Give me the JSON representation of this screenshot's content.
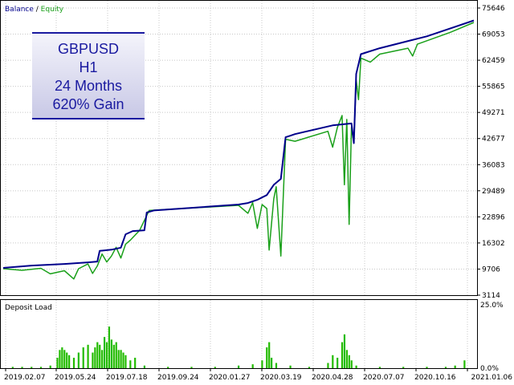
{
  "chart_data": [
    {
      "type": "line",
      "title_parts": [
        "Balance",
        " / ",
        "Equity"
      ],
      "colors": {
        "balance": "#00008b",
        "equity": "#1aa01a",
        "grid": "#c8c8c8",
        "text": "#000000"
      },
      "ylim": [
        3114,
        75646
      ],
      "yticks": [
        3114,
        9706,
        16302,
        22896,
        29489,
        36083,
        42677,
        49271,
        55865,
        62459,
        69053,
        75646
      ],
      "xticks": [
        "2019.02.07",
        "2019.05.24",
        "2019.07.18",
        "2019.09.24",
        "2020.01.27",
        "2020.03.19",
        "2020.04.28",
        "2020.07.07",
        "2020.10.16",
        "2021.01.06"
      ],
      "series": [
        {
          "name": "Balance",
          "x": [
            0,
            0.06,
            0.13,
            0.18,
            0.2,
            0.205,
            0.23,
            0.25,
            0.26,
            0.275,
            0.3,
            0.305,
            0.32,
            0.5,
            0.52,
            0.54,
            0.56,
            0.575,
            0.59,
            0.6,
            0.61,
            0.62,
            0.7,
            0.74,
            0.745,
            0.75,
            0.76,
            0.8,
            0.9,
            0.95,
            1.0
          ],
          "values": [
            10000,
            10600,
            11000,
            11400,
            11600,
            14300,
            14600,
            15100,
            18500,
            19300,
            19500,
            24000,
            24500,
            26000,
            26400,
            27200,
            28400,
            31000,
            32500,
            43000,
            43400,
            43800,
            46000,
            46500,
            41500,
            59000,
            64000,
            65500,
            68500,
            70500,
            72500
          ]
        },
        {
          "name": "Equity",
          "x": [
            0,
            0.04,
            0.08,
            0.1,
            0.13,
            0.15,
            0.16,
            0.18,
            0.19,
            0.2,
            0.21,
            0.22,
            0.23,
            0.24,
            0.25,
            0.26,
            0.27,
            0.29,
            0.31,
            0.5,
            0.52,
            0.53,
            0.54,
            0.55,
            0.56,
            0.565,
            0.575,
            0.58,
            0.59,
            0.6,
            0.62,
            0.69,
            0.7,
            0.71,
            0.72,
            0.725,
            0.73,
            0.735,
            0.74,
            0.745,
            0.75,
            0.755,
            0.76,
            0.78,
            0.8,
            0.86,
            0.87,
            0.88,
            0.95,
            1.0
          ],
          "values": [
            9800,
            9400,
            9900,
            8500,
            9300,
            7200,
            9800,
            11000,
            8600,
            10500,
            13500,
            11500,
            13000,
            15200,
            12500,
            16000,
            17000,
            19500,
            24500,
            25800,
            23800,
            26500,
            20000,
            26000,
            25000,
            14500,
            27500,
            30500,
            13000,
            42500,
            42000,
            44500,
            40500,
            45500,
            48500,
            31000,
            47500,
            21000,
            45500,
            41500,
            57500,
            52500,
            63000,
            62000,
            64000,
            65500,
            63500,
            66500,
            69500,
            72000
          ]
        }
      ]
    },
    {
      "type": "bar",
      "title": "Deposit Load",
      "ylim": [
        0,
        25
      ],
      "yticks": [
        "25.0%",
        "0.0%"
      ],
      "colors": {
        "bar": "#22bb00"
      },
      "x": [
        0.02,
        0.04,
        0.06,
        0.08,
        0.1,
        0.115,
        0.12,
        0.125,
        0.13,
        0.135,
        0.14,
        0.15,
        0.16,
        0.17,
        0.18,
        0.19,
        0.195,
        0.2,
        0.205,
        0.21,
        0.215,
        0.22,
        0.225,
        0.23,
        0.235,
        0.24,
        0.245,
        0.25,
        0.255,
        0.26,
        0.27,
        0.28,
        0.3,
        0.35,
        0.4,
        0.45,
        0.5,
        0.53,
        0.55,
        0.56,
        0.565,
        0.57,
        0.58,
        0.61,
        0.65,
        0.69,
        0.7,
        0.71,
        0.72,
        0.725,
        0.73,
        0.735,
        0.74,
        0.75,
        0.8,
        0.85,
        0.9,
        0.94,
        0.96,
        0.98
      ],
      "values": [
        0.5,
        0.5,
        0.5,
        0.5,
        1,
        4,
        7,
        8,
        7,
        6,
        5,
        4,
        6,
        8,
        9,
        6,
        8,
        10,
        9,
        7,
        12,
        10,
        16,
        11,
        9,
        10,
        7,
        7,
        6,
        5,
        3,
        4,
        1,
        0.5,
        0.5,
        0.5,
        1,
        1.5,
        3,
        8,
        10,
        4,
        2,
        1,
        0.5,
        2,
        5,
        4,
        10,
        13,
        7,
        5,
        3,
        1,
        0.5,
        0.5,
        0.5,
        0.5,
        1,
        3
      ]
    }
  ],
  "overlay": {
    "lines": [
      "GBPUSD",
      "H1",
      "24 Months",
      "620% Gain"
    ]
  }
}
